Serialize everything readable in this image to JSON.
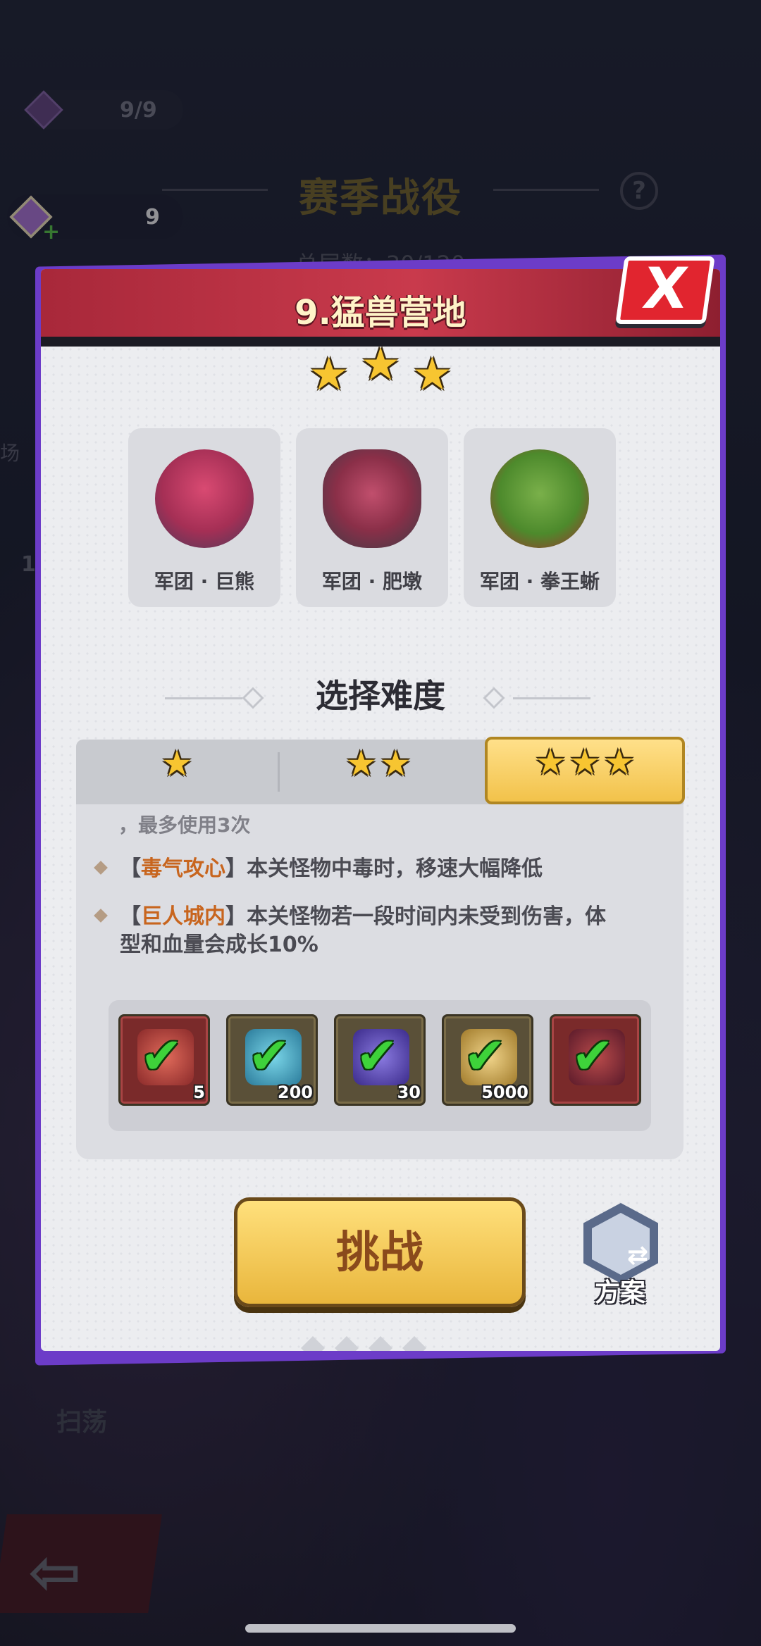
{
  "hud": {
    "ticket_count": "9/9",
    "energy_count": "9",
    "season_title": "赛季战役",
    "layer_label": "总层数：30/120",
    "side_label": "场",
    "side_number": "1",
    "sweep_label": "扫荡"
  },
  "dialog": {
    "title": "9.猛兽营地",
    "close_symbol": "X",
    "earned_stars": 3,
    "monsters": [
      {
        "name": "军团 · 巨熊"
      },
      {
        "name": "军团 · 肥墩"
      },
      {
        "name": "军团 · 拳王蜥"
      }
    ],
    "section_title": "选择难度",
    "difficulty_tabs": [
      {
        "stars": 1,
        "selected": false
      },
      {
        "stars": 2,
        "selected": false
      },
      {
        "stars": 3,
        "selected": true
      }
    ],
    "truncated_text": "，最多使用3次",
    "rules": [
      {
        "open": "【",
        "name": "毒气攻心",
        "close": "】",
        "text": "本关怪物中毒时，移速大幅降低"
      },
      {
        "open": "【",
        "name": "巨人城内",
        "close": "】",
        "text": "本关怪物若一段时间内未受到伤害，体",
        "text2": "型和血量会成长10%"
      }
    ],
    "rewards": [
      {
        "icon": "apple-icon",
        "qty": "5",
        "claimed": true
      },
      {
        "icon": "diamond-icon",
        "qty": "200",
        "claimed": true
      },
      {
        "icon": "crystal-icon",
        "qty": "30",
        "claimed": true
      },
      {
        "icon": "wing-icon",
        "qty": "5000",
        "claimed": true
      },
      {
        "icon": "book-icon",
        "qty": "",
        "claimed": true
      }
    ],
    "challenge_label": "挑战",
    "plan_label": "方案"
  },
  "colors": {
    "header_red": "#c93a4c",
    "accent_gold": "#f2c24a",
    "rule_orange": "#c8651e",
    "check_green": "#3ed23a"
  }
}
